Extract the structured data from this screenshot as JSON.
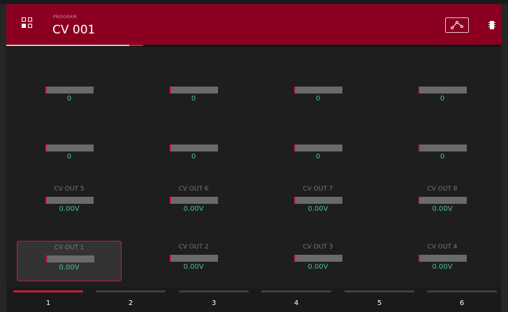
{
  "header": {
    "section_label": "PROGRAM",
    "program_name": "CV 001",
    "env_icon": "envelope-curve-icon",
    "menu_icon": "chip-icon",
    "grid_icon": "grid-icon"
  },
  "pads": [
    {
      "label": "",
      "value": "0"
    },
    {
      "label": "",
      "value": "0"
    },
    {
      "label": "",
      "value": "0"
    },
    {
      "label": "",
      "value": "0"
    },
    {
      "label": "",
      "value": "0"
    },
    {
      "label": "",
      "value": "0"
    },
    {
      "label": "",
      "value": "0"
    },
    {
      "label": "",
      "value": "0"
    },
    {
      "label": "CV OUT 5",
      "value": "0.00V"
    },
    {
      "label": "CV OUT 6",
      "value": "0.00V"
    },
    {
      "label": "CV OUT 7",
      "value": "0.00V"
    },
    {
      "label": "CV OUT 8",
      "value": "0.00V"
    },
    {
      "label": "CV OUT 1",
      "value": "0.00V",
      "selected": true
    },
    {
      "label": "CV OUT 2",
      "value": "0.00V"
    },
    {
      "label": "CV OUT 3",
      "value": "0.00V"
    },
    {
      "label": "CV OUT 4",
      "value": "0.00V"
    }
  ],
  "tabs": [
    {
      "label": "1",
      "active": true
    },
    {
      "label": "2"
    },
    {
      "label": "3"
    },
    {
      "label": "4"
    },
    {
      "label": "5"
    },
    {
      "label": "6"
    }
  ],
  "colors": {
    "header": "#8b0021",
    "accent": "#c41e3a",
    "value": "#4dbf91"
  }
}
